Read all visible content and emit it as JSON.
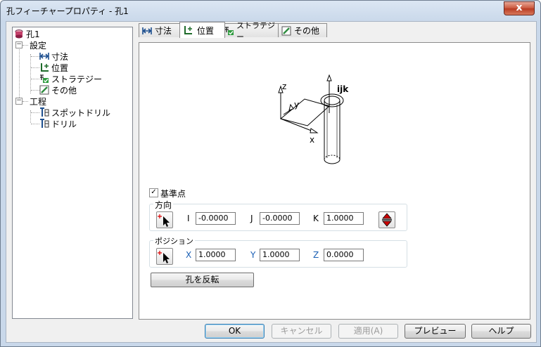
{
  "window": {
    "title": "孔フィーチャープロパティ - 孔1",
    "close_label": "x"
  },
  "tree": {
    "root": "孔1",
    "settings": {
      "label": "設定",
      "children": [
        "寸法",
        "位置",
        "ストラテジー",
        "その他"
      ]
    },
    "process": {
      "label": "工程",
      "children": [
        "スポットドリル",
        "ドリル"
      ]
    }
  },
  "tabs": [
    {
      "label": "寸法",
      "icon": "dimension-icon",
      "active": false
    },
    {
      "label": "位置",
      "icon": "position-icon",
      "active": true
    },
    {
      "label": "ストラテジー",
      "icon": "strategy-icon",
      "active": false
    },
    {
      "label": "その他",
      "icon": "other-icon",
      "active": false
    }
  ],
  "diagram": {
    "axis_x": "x",
    "axis_y": "y",
    "axis_z": "z",
    "ijk": "ijk"
  },
  "reference_point": {
    "label": "基準点",
    "checked": true
  },
  "direction": {
    "title": "方向",
    "i_label": "I",
    "i_value": "-0.0000",
    "j_label": "J",
    "j_value": "-0.0000",
    "k_label": "K",
    "k_value": "1.0000"
  },
  "position": {
    "title": "ポジション",
    "x_label": "X",
    "x_value": "1.0000",
    "y_label": "Y",
    "y_value": "1.0000",
    "z_label": "Z",
    "z_value": "0.0000"
  },
  "flip_button": "孔を反転",
  "buttons": {
    "ok": "OK",
    "cancel": "キャンセル",
    "apply": "適用(A)",
    "preview": "プレビュー",
    "help": "ヘルプ"
  },
  "colors": {
    "accent_blue": "#1a5fb4",
    "arrow_red": "#cc0000",
    "title_gradient": "#c9d8ea"
  }
}
